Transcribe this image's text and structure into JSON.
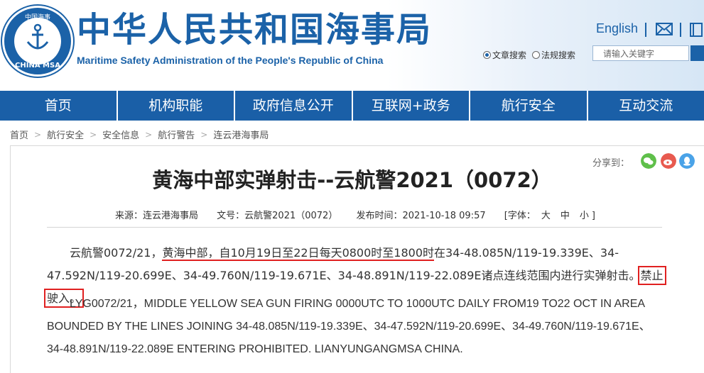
{
  "header": {
    "logo_top": "中国海事",
    "logo_bottom": "CHINA MSA",
    "site_title": "中华人民共和国海事局",
    "site_subtitle": "Maritime Safety Administration of the People's Republic of China",
    "lang_link": "English",
    "search_options": [
      "文章搜索",
      "法规搜索"
    ],
    "search_selected": "文章搜索",
    "search_placeholder": "请输入关键字"
  },
  "nav": {
    "items": [
      "首页",
      "机构职能",
      "政府信息公开",
      "互联网+政务",
      "航行安全",
      "互动交流"
    ]
  },
  "breadcrumb": [
    "首页",
    "航行安全",
    "安全信息",
    "航行警告",
    "连云港海事局"
  ],
  "article": {
    "share_label": "分享到：",
    "title": "黄海中部实弹射击--云航警2021（0072）",
    "meta": {
      "source": "来源：连云港海事局",
      "doc_no": "文号：云航警2021（0072）",
      "published": "发布时间：2021-10-18 09:57",
      "font_label": "[字体：",
      "font_sizes": [
        "大",
        "中",
        "小"
      ],
      "font_close": "]"
    },
    "cn_para": {
      "prefix": "云航警0072/21，",
      "underlined": "黄海中部，自10月19日至22日每天0800时至1800时",
      "middle": "在34-48.085N/119-19.339E、34-47.592N/119-20.699E、34-49.760N/119-19.671E、34-48.891N/119-22.089E诸点连线范围内进行实弹射击。",
      "boxed": "禁止驶入。"
    },
    "en_para": "LYG0072/21，MIDDLE YELLOW SEA GUN FIRING 0000UTC TO 1000UTC DAILY FROM19 TO22 OCT IN AREA BOUNDED BY THE LINES JOINING 34-48.085N/119-19.339E、34-47.592N/119-20.699E、34-49.760N/119-19.671E、34-48.891N/119-22.089E ENTERING PROHIBITED. LIANYUNGANGMSA CHINA."
  },
  "colors": {
    "brand_blue": "#1b62a8",
    "nav_blue": "#1a5fa7",
    "highlight_red": "#e02020"
  }
}
